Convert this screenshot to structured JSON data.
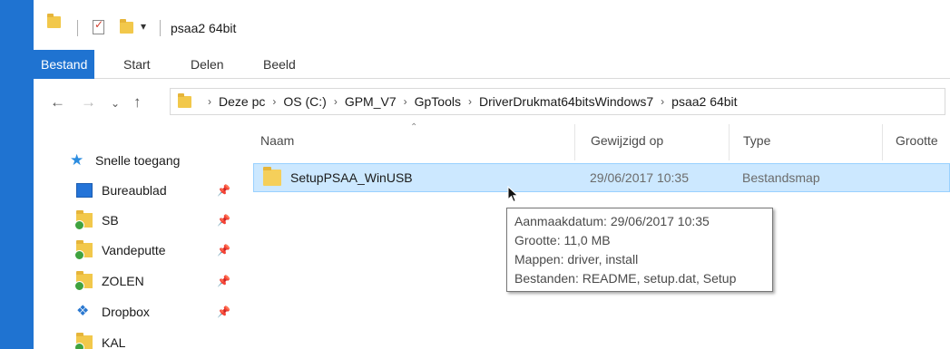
{
  "window": {
    "title": "psaa2 64bit"
  },
  "quick_access_toolbar": {
    "dropdown_glyph": "▾"
  },
  "ribbon": {
    "tabs": [
      {
        "label": "Bestand",
        "active": true
      },
      {
        "label": "Start",
        "active": false
      },
      {
        "label": "Delen",
        "active": false
      },
      {
        "label": "Beeld",
        "active": false
      }
    ]
  },
  "address_bar": {
    "breadcrumbs": [
      "Deze pc",
      "OS (C:)",
      "GPM_V7",
      "GpTools",
      "DriverDrukmat64bitsWindows7",
      "psaa2 64bit"
    ]
  },
  "nav_pane": {
    "quick_access_label": "Snelle toegang",
    "items": [
      {
        "label": "Bureaublad",
        "icon": "desktop-icon",
        "pinned": true
      },
      {
        "label": "SB",
        "icon": "folder-icon",
        "pinned": true
      },
      {
        "label": "Vandeputte",
        "icon": "folder-icon",
        "pinned": true
      },
      {
        "label": "ZOLEN",
        "icon": "folder-icon",
        "pinned": true
      },
      {
        "label": "Dropbox",
        "icon": "dropbox-icon",
        "pinned": true
      },
      {
        "label": "KAL",
        "icon": "folder-icon",
        "pinned": false
      }
    ]
  },
  "file_list": {
    "columns": [
      "Naam",
      "Gewijzigd op",
      "Type",
      "Grootte"
    ],
    "rows": [
      {
        "name": "SetupPSAA_WinUSB",
        "modified": "29/06/2017 10:35",
        "type": "Bestandsmap",
        "size": ""
      }
    ]
  },
  "tooltip": {
    "lines": [
      "Aanmaakdatum: 29/06/2017 10:35",
      "Grootte: 11,0 MB",
      "Mappen: driver, install",
      "Bestanden: README, setup.dat, Setup"
    ]
  },
  "colors": {
    "accent": "#1f73d1",
    "selection": "#cce8ff",
    "selection_border": "#99d1ff",
    "folder": "#f2c84b"
  }
}
